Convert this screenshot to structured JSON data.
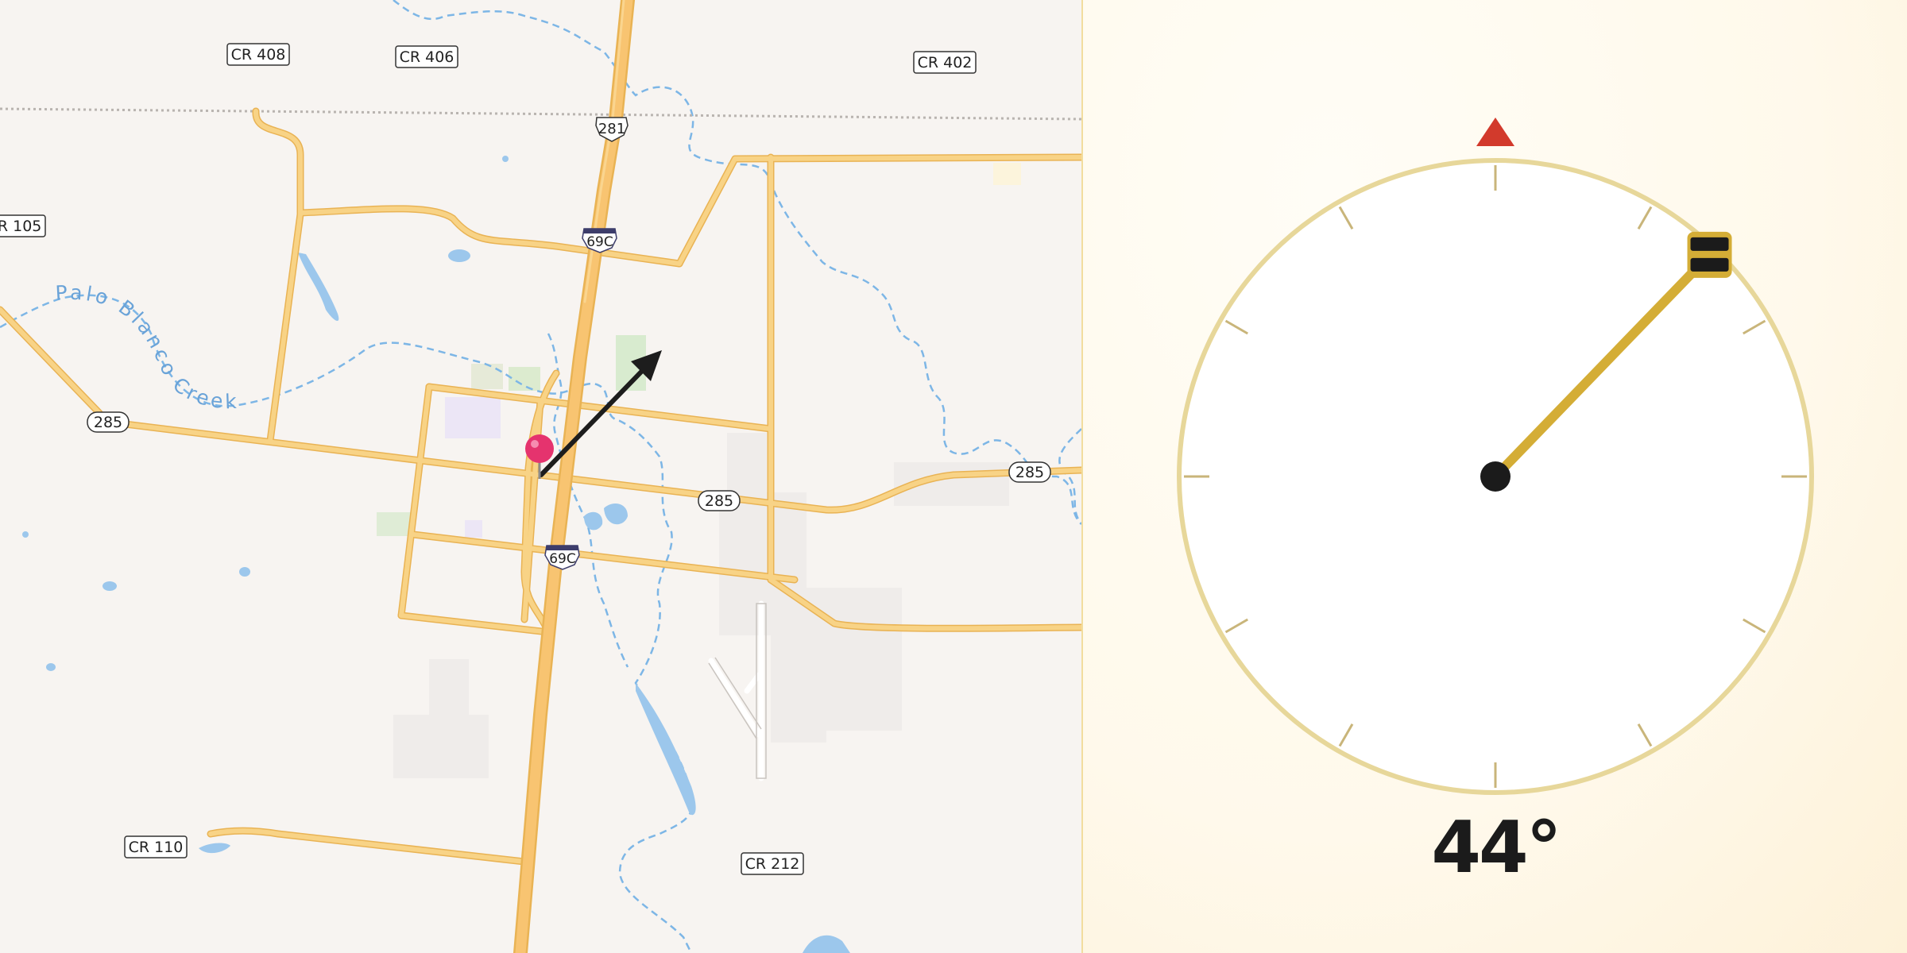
{
  "map": {
    "road_labels": {
      "cr408": "CR 408",
      "cr406": "CR 406",
      "cr402": "CR 402",
      "cr105": "CR 105",
      "cr110": "CR 110",
      "cr212": "CR 212",
      "us285_west": "285",
      "us285_center": "285",
      "us285_east": "285",
      "us281": "281",
      "i69c_north": "69C",
      "i69c_south": "69C"
    },
    "water_label": "Palo Blanco Creek",
    "colors": {
      "road": "#f7c66a",
      "road_casing": "#e9b354",
      "water": "#7db6e6",
      "background": "#f7f4f1",
      "pin": "#e5336e",
      "border": "#b9b4b0"
    },
    "icons": [
      "location-pin-icon",
      "direction-arrow-icon"
    ]
  },
  "compass": {
    "heading_text": "44°",
    "heading_degrees": 44,
    "colors": {
      "ring": "#e7d79a",
      "needle": "#d4ad36",
      "north_marker": "#d23a2c",
      "hub": "#1b1b1b"
    }
  }
}
